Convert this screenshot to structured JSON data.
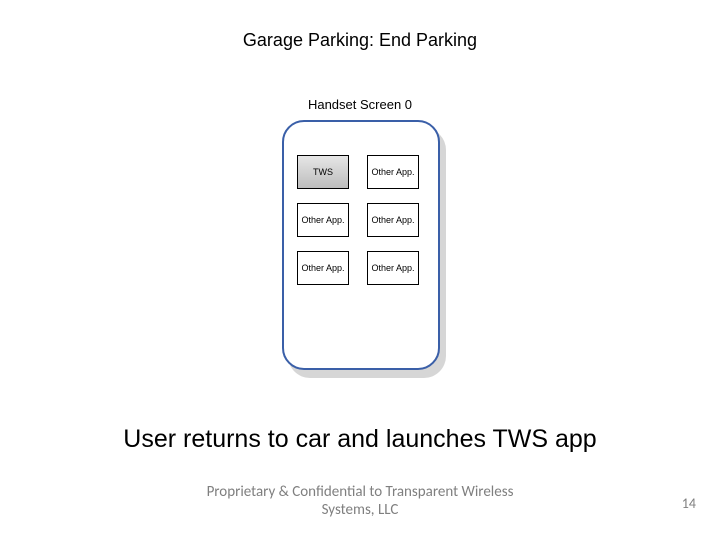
{
  "title": "Garage Parking: End Parking",
  "screen_label": "Handset Screen 0",
  "apps": [
    {
      "label": "TWS",
      "variant": "tws"
    },
    {
      "label": "Other\nApp."
    },
    {
      "label": "Other\nApp."
    },
    {
      "label": "Other\nApp."
    },
    {
      "label": "Other\nApp."
    },
    {
      "label": "Other\nApp."
    }
  ],
  "caption": "User returns to car and launches TWS app",
  "footer_line1": "Proprietary & Confidential to Transparent Wireless",
  "footer_line2": "Systems, LLC",
  "page_number": "14"
}
